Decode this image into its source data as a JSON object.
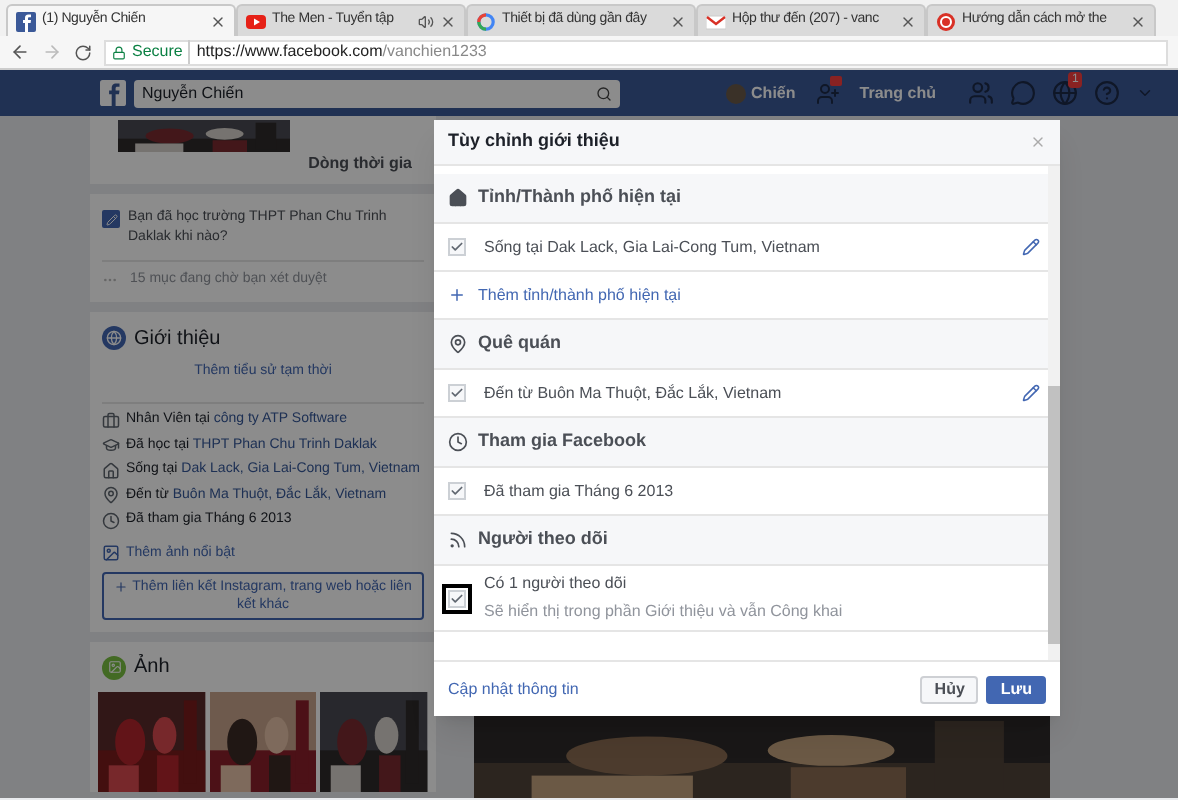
{
  "browser": {
    "tabs": [
      {
        "title": "(1) Nguyễn Chiến",
        "audio": false,
        "selected": true
      },
      {
        "title": "The Men - Tuyển tập",
        "audio": true,
        "selected": false
      },
      {
        "title": "Thiết bị đã dùng gần đây",
        "audio": false,
        "selected": false
      },
      {
        "title": "Hộp thư đến (207) - vanc",
        "audio": false,
        "selected": false
      },
      {
        "title": "Hướng dẫn cách mở the",
        "audio": false,
        "selected": false
      }
    ],
    "address": {
      "security": "Secure",
      "url_host": "https://www.facebook.com",
      "url_path": "/vanchien1233"
    }
  },
  "topbar": {
    "search_value": "Nguyễn Chiến",
    "profile_name": "Chiến",
    "home": "Trang chủ",
    "friend_requests_alert": true,
    "nav": [
      {
        "kind": "friends"
      },
      {
        "kind": "messenger"
      },
      {
        "kind": "notifications",
        "badge": "1"
      },
      {
        "kind": "help"
      }
    ]
  },
  "timeline": {
    "cover_label": "Dòng thời gia"
  },
  "prompt": {
    "question": "Bạn đã học trường THPT Phan Chu Trinh Daklak khi nào?",
    "pending": "15 mục đang chờ bạn xét duyệt"
  },
  "intro": {
    "title": "Giới thiệu",
    "bio_link": "Thêm tiểu sử tạm thời",
    "items": [
      {
        "kind": "work",
        "prefix": "Nhân Viên tại",
        "link": "công ty ATP Software"
      },
      {
        "kind": "education",
        "prefix": "Đã học tại",
        "link": "THPT Phan Chu Trinh Daklak"
      },
      {
        "kind": "home",
        "prefix": "Sống tại",
        "link": "Dak Lack, Gia Lai-Cong Tum, Vietnam"
      },
      {
        "kind": "hometown",
        "prefix": "Đến từ",
        "link": "Buôn Ma Thuột, Đắc Lắk, Vietnam"
      },
      {
        "kind": "joined",
        "prefix": "Đã tham gia Tháng 6 2013"
      }
    ],
    "featured_link": "Thêm ảnh nổi bật",
    "add_links_button": "Thêm liên kết Instagram, trang web hoặc liên kết khác"
  },
  "photos": {
    "title": "Ảnh"
  },
  "modal": {
    "title": "Tùy chỉnh giới thiệu",
    "sections": [
      {
        "title": "Tỉnh/Thành phố hiện tại",
        "rows": [
          {
            "kind": "item",
            "text": "Sống tại Dak Lack, Gia Lai-Cong Tum, Vietnam",
            "checked": true,
            "focused": false,
            "editable": true
          },
          {
            "kind": "add",
            "text": "Thêm tỉnh/thành phố hiện tại"
          }
        ]
      },
      {
        "title": "Quê quán",
        "rows": [
          {
            "kind": "item",
            "text": "Đến từ Buôn Ma Thuột, Đắc Lắk, Vietnam",
            "checked": true,
            "focused": false,
            "editable": true
          }
        ]
      },
      {
        "title": "Tham gia Facebook",
        "rows": [
          {
            "kind": "item",
            "text": "Đã tham gia Tháng 6 2013",
            "checked": true,
            "focused": false,
            "editable": false
          }
        ]
      },
      {
        "title": "Người theo dõi",
        "rows": [
          {
            "kind": "item",
            "text": "Có 1 người theo dõi",
            "subtext": "Sẽ hiển thị trong phần Giới thiệu và vẫn Công khai",
            "checked": true,
            "focused": true,
            "editable": false
          }
        ]
      }
    ],
    "footer_link": "Cập nhật thông tin",
    "buttons": [
      {
        "label": "Hủy",
        "kind": "secondary"
      },
      {
        "label": "Lưu",
        "kind": "primary"
      }
    ]
  }
}
